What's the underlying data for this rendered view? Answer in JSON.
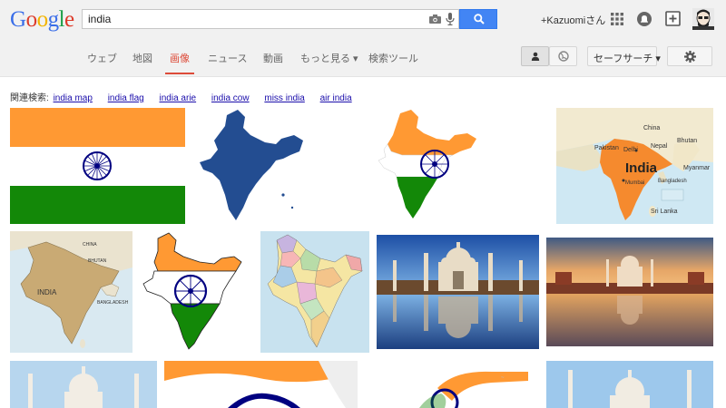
{
  "logo": {
    "l1": "G",
    "l2": "o",
    "l3": "o",
    "l4": "g",
    "l5": "l",
    "l6": "e"
  },
  "search": {
    "query": "india"
  },
  "account": {
    "name": "+Kazuomiさん"
  },
  "tabs": [
    {
      "label": "ウェブ"
    },
    {
      "label": "地図"
    },
    {
      "label": "画像"
    },
    {
      "label": "ニュース"
    },
    {
      "label": "動画"
    },
    {
      "label": "もっと見る ▾"
    },
    {
      "label": "検索ツール"
    }
  ],
  "tools": {
    "safesearch": "セーフサーチ ▾"
  },
  "related": {
    "prefix": "関連検索:",
    "items": [
      {
        "label": "india map"
      },
      {
        "label": "india flag"
      },
      {
        "label": "india arie"
      },
      {
        "label": "india cow"
      },
      {
        "label": "miss india"
      },
      {
        "label": "air india"
      }
    ]
  },
  "map_labels": {
    "china": "China",
    "pakistan": "Pakistan",
    "nepal": "Nepal",
    "bhutan": "Bhutan",
    "delhi": "Delhi",
    "india_big": "India",
    "myanmar": "Myanmar",
    "bangladesh": "Bangladesh",
    "mumbai": "Mumbai",
    "srilanka": "Sri Lanka",
    "india_small": "INDIA",
    "bhutan_small": "BHUTAN",
    "bangladesh_small": "BANGLADESH",
    "china_small": "CHINA"
  },
  "colors": {
    "saffron": "#ff9933",
    "green": "#138808",
    "chakra": "#000080",
    "accent_red": "#dd4b39",
    "search_blue": "#4285f4"
  }
}
